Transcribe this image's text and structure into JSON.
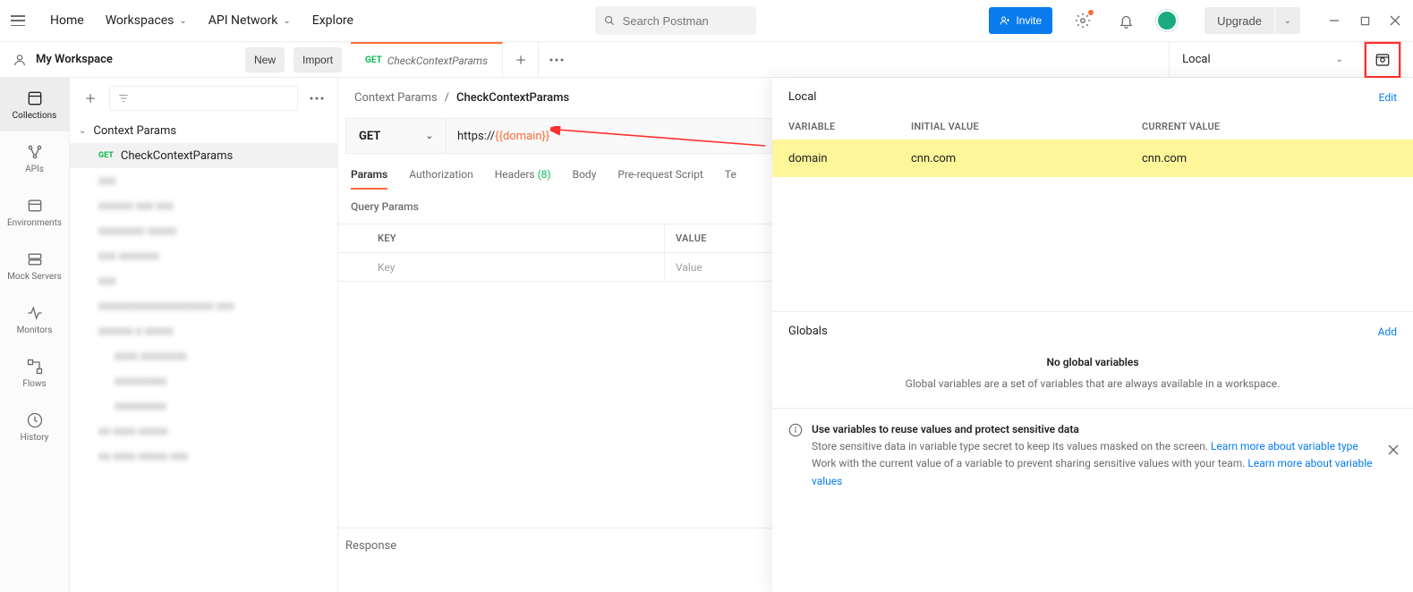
{
  "topnav": {
    "home": "Home",
    "workspaces": "Workspaces",
    "api_network": "API Network",
    "explore": "Explore"
  },
  "search": {
    "placeholder": "Search Postman"
  },
  "invite": "Invite",
  "upgrade": "Upgrade",
  "workspace": {
    "name": "My Workspace",
    "new": "New",
    "import": "Import"
  },
  "tab": {
    "method": "GET",
    "title": "CheckContextParams"
  },
  "env": {
    "selected": "Local"
  },
  "rail": {
    "collections": "Collections",
    "apis": "APIs",
    "env": "Environments",
    "mock": "Mock Servers",
    "monitors": "Monitors",
    "flows": "Flows",
    "history": "History"
  },
  "tree": {
    "folder": "Context Params",
    "item_method": "GET",
    "item_name": "CheckContextParams"
  },
  "breadcrumb": {
    "parent": "Context Params",
    "sep": "/",
    "current": "CheckContextParams"
  },
  "request": {
    "method": "GET",
    "url_prefix": "https://",
    "url_var": "{{domain}}"
  },
  "reqtabs": {
    "params": "Params",
    "auth": "Authorization",
    "headers": "Headers",
    "headers_count": "(8)",
    "body": "Body",
    "prerequest": "Pre-request Script",
    "tests": "Te"
  },
  "qp": {
    "title": "Query Params",
    "key_h": "KEY",
    "val_h": "VALUE",
    "key_ph": "Key",
    "val_ph": "Value"
  },
  "response": "Response",
  "panel": {
    "local": "Local",
    "edit": "Edit",
    "var_h": "VARIABLE",
    "init_h": "INITIAL VALUE",
    "cur_h": "CURRENT VALUE",
    "row_var": "domain",
    "row_init": "cnn.com",
    "row_cur": "cnn.com",
    "globals": "Globals",
    "add": "Add",
    "no_globals": "No global variables",
    "globals_desc": "Global variables are a set of variables that are always available in a workspace.",
    "tip_title": "Use variables to reuse values and protect sensitive data",
    "tip_l1a": "Store sensitive data in variable type secret to keep its values masked on the screen. ",
    "tip_l1b": "Learn more about variable type",
    "tip_l2a": "Work with the current value of a variable to prevent sharing sensitive values with your team. ",
    "tip_l2b": "Learn more about variable values"
  }
}
